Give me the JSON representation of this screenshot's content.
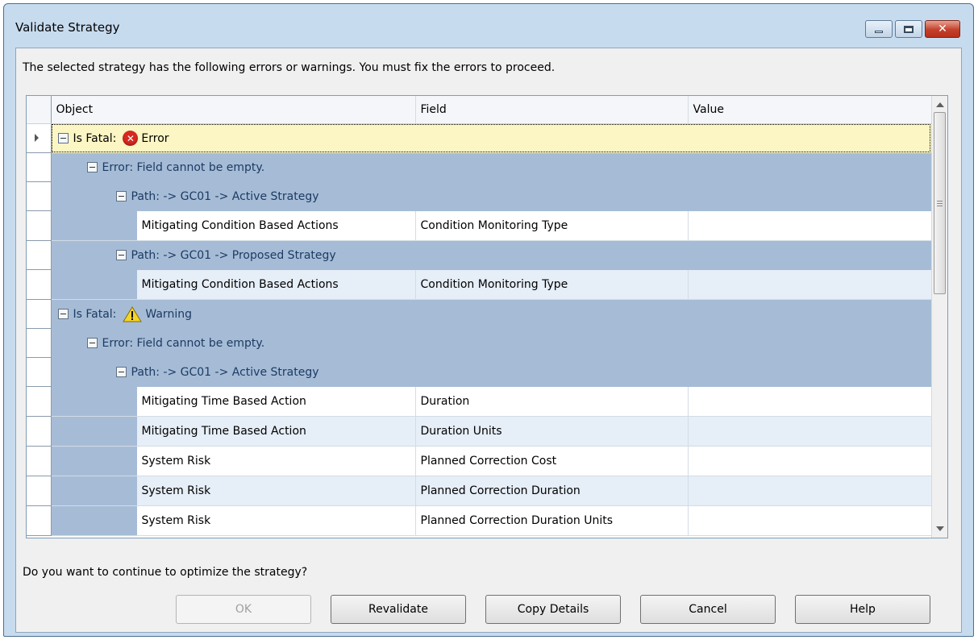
{
  "window": {
    "title": "Validate Strategy",
    "close_glyph": "✕"
  },
  "message": "The selected strategy has the following errors or warnings.  You must fix the errors to proceed.",
  "columns": {
    "object": "Object",
    "field": "Field",
    "value": "Value"
  },
  "groups": {
    "fatal_error": {
      "label": "Is Fatal:",
      "status": "Error",
      "icon": "error-icon"
    },
    "error_1": {
      "label": "Error: Field cannot be empty."
    },
    "path_1": {
      "label": "Path: -> GC01 -> Active Strategy"
    },
    "path_2": {
      "label": "Path: -> GC01 -> Proposed Strategy"
    },
    "fatal_warning": {
      "label": "Is Fatal:",
      "status": "Warning",
      "icon": "warning-icon"
    },
    "error_2": {
      "label": "Error: Field cannot be empty."
    },
    "path_3": {
      "label": "Path: -> GC01 -> Active Strategy"
    }
  },
  "rows": [
    {
      "object": "Mitigating Condition Based Actions",
      "field": "Condition Monitoring Type",
      "value": ""
    },
    {
      "object": "Mitigating Condition Based Actions",
      "field": "Condition Monitoring Type",
      "value": ""
    },
    {
      "object": "Mitigating Time Based Action",
      "field": "Duration",
      "value": ""
    },
    {
      "object": "Mitigating Time Based Action",
      "field": "Duration Units",
      "value": ""
    },
    {
      "object": "System Risk",
      "field": "Planned Correction Cost",
      "value": ""
    },
    {
      "object": "System Risk",
      "field": "Planned Correction Duration",
      "value": ""
    },
    {
      "object": "System Risk",
      "field": "Planned Correction Duration Units",
      "value": ""
    }
  ],
  "question": "Do you want to continue to optimize the strategy?",
  "buttons": {
    "ok": "OK",
    "revalidate": "Revalidate",
    "copy_details": "Copy Details",
    "cancel": "Cancel",
    "help": "Help"
  },
  "colors": {
    "title_bar": "#c7dbef",
    "group_row": "#a6bcd6",
    "group_text": "#1d3b63",
    "active_row": "#fbf6c4",
    "alt_row": "#e6eef7",
    "error_icon": "#d6281e",
    "warning_icon": "#f5d42a"
  }
}
